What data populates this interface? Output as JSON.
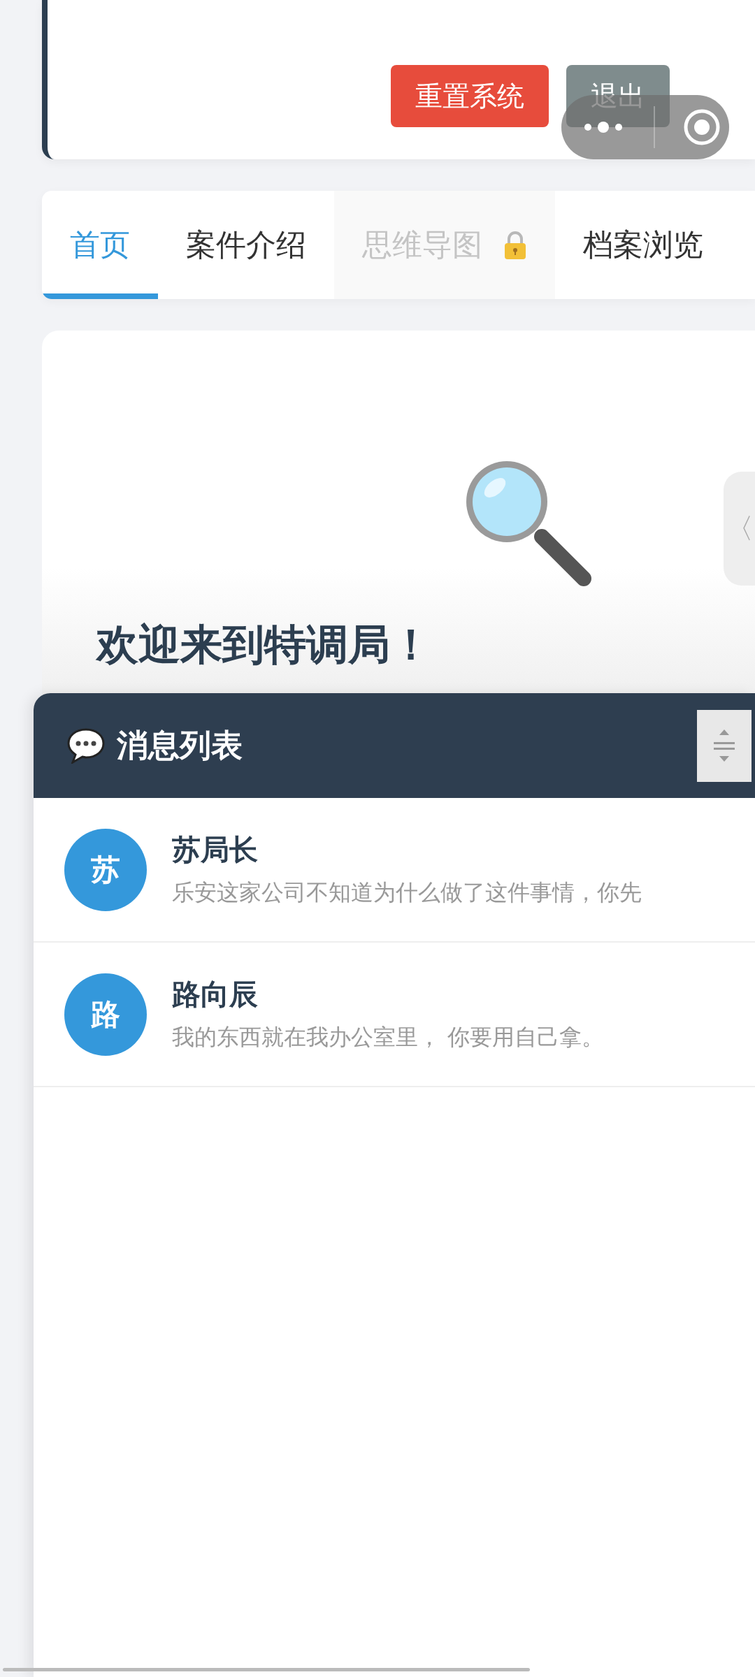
{
  "top_card": {
    "buttons": [
      {
        "label": "重置系统",
        "kind": "danger"
      },
      {
        "label": "退出",
        "kind": "secondary"
      }
    ]
  },
  "tabs": [
    {
      "label": "首页",
      "selected": true,
      "locked": false
    },
    {
      "label": "案件介绍",
      "selected": false,
      "locked": false
    },
    {
      "label": "思维导图",
      "selected": false,
      "locked": true
    },
    {
      "label": "档案浏览",
      "selected": false,
      "locked": false
    }
  ],
  "side_handle": {
    "glyph": "〈"
  },
  "welcome": {
    "title": "欢迎来到特调局！"
  },
  "messages": {
    "title": "消息列表",
    "items": [
      {
        "avatar": "苏",
        "name": "苏局长",
        "preview": "乐安这家公司不知道为什么做了这件事情，你先"
      },
      {
        "avatar": "路",
        "name": "路向辰",
        "preview": "我的东西就在我办公室里， 你要用自己拿。"
      }
    ]
  }
}
